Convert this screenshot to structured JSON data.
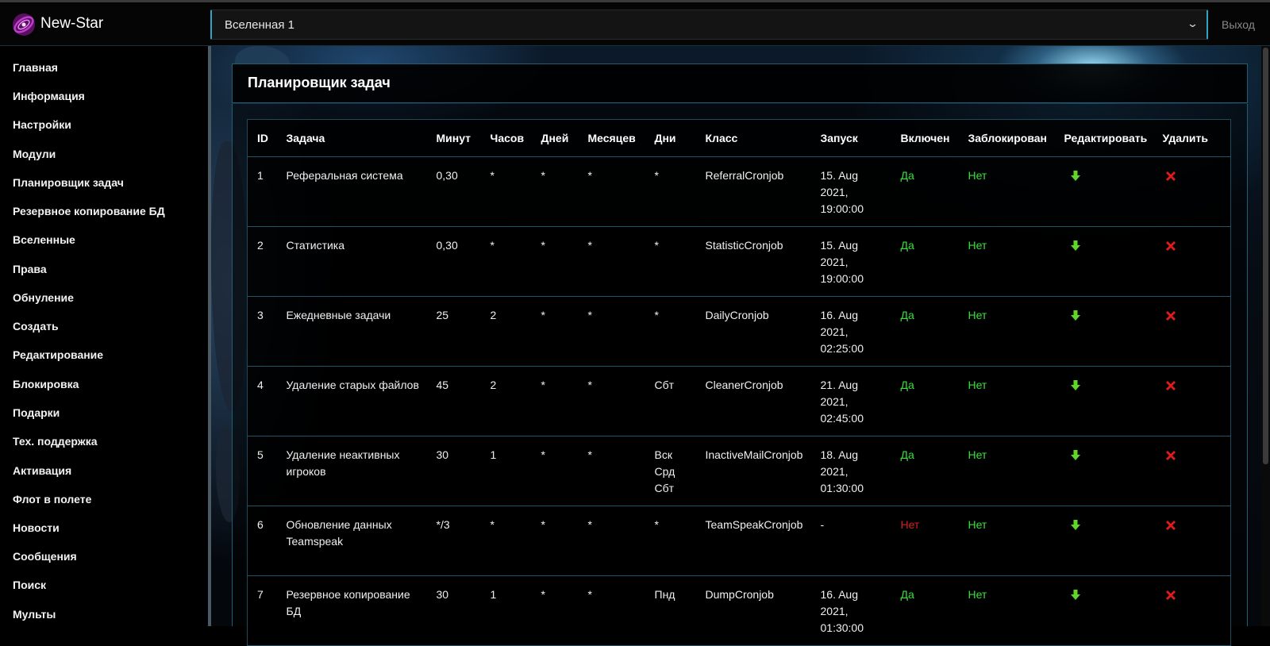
{
  "header": {
    "brand": "New-Star",
    "universe_select": {
      "selected": "Вселенная 1"
    },
    "logout_label": "Выход"
  },
  "sidebar": {
    "items": [
      {
        "label": "Главная"
      },
      {
        "label": "Информация"
      },
      {
        "label": "Настройки"
      },
      {
        "label": "Модули"
      },
      {
        "label": "Планировщик задач"
      },
      {
        "label": "Резервное копирование БД"
      },
      {
        "label": "Вселенные"
      },
      {
        "label": "Права"
      },
      {
        "label": "Обнуление"
      },
      {
        "label": "Создать"
      },
      {
        "label": "Редактирование"
      },
      {
        "label": "Блокировка"
      },
      {
        "label": "Подарки"
      },
      {
        "label": "Тех. поддержка"
      },
      {
        "label": "Активация"
      },
      {
        "label": "Флот в полете"
      },
      {
        "label": "Новости"
      },
      {
        "label": "Сообщения"
      },
      {
        "label": "Поиск"
      },
      {
        "label": "Мульты"
      }
    ]
  },
  "panel": {
    "title": "Планировщик задач"
  },
  "table": {
    "headers": [
      "ID",
      "Задача",
      "Минут",
      "Часов",
      "Дней",
      "Месяцев",
      "Дни",
      "Класс",
      "Запуск",
      "Включен",
      "Заблокирован",
      "Редактировать",
      "Удалить"
    ],
    "rows": [
      {
        "id": "1",
        "task": "Реферальная система",
        "min": "0,30",
        "hour": "*",
        "day": "*",
        "month": "*",
        "dow": "*",
        "class": "ReferralCronjob",
        "run": "15. Aug 2021, 19:00:00",
        "enabled": "Да",
        "locked": "Нет"
      },
      {
        "id": "2",
        "task": "Статистика",
        "min": "0,30",
        "hour": "*",
        "day": "*",
        "month": "*",
        "dow": "*",
        "class": "StatisticCronjob",
        "run": "15. Aug 2021, 19:00:00",
        "enabled": "Да",
        "locked": "Нет"
      },
      {
        "id": "3",
        "task": "Ежедневные задачи",
        "min": "25",
        "hour": "2",
        "day": "*",
        "month": "*",
        "dow": "*",
        "class": "DailyCronjob",
        "run": "16. Aug 2021, 02:25:00",
        "enabled": "Да",
        "locked": "Нет"
      },
      {
        "id": "4",
        "task": "Удаление старых файлов",
        "min": "45",
        "hour": "2",
        "day": "*",
        "month": "*",
        "dow": "Сбт",
        "class": "CleanerCronjob",
        "run": "21. Aug 2021, 02:45:00",
        "enabled": "Да",
        "locked": "Нет"
      },
      {
        "id": "5",
        "task": "Удаление неактивных игроков",
        "min": "30",
        "hour": "1",
        "day": "*",
        "month": "*",
        "dow": "Вск Срд Сбт",
        "class": "InactiveMailCronjob",
        "run": "18. Aug 2021, 01:30:00",
        "enabled": "Да",
        "locked": "Нет"
      },
      {
        "id": "6",
        "task": "Обновление данных Teamspeak",
        "min": "*/3",
        "hour": "*",
        "day": "*",
        "month": "*",
        "dow": "*",
        "class": "TeamSpeakCronjob",
        "run": "-",
        "enabled": "Нет",
        "locked": "Нет"
      },
      {
        "id": "7",
        "task": "Резервное копирование БД",
        "min": "30",
        "hour": "1",
        "day": "*",
        "month": "*",
        "dow": "Пнд",
        "class": "DumpCronjob",
        "run": "16. Aug 2021, 01:30:00",
        "enabled": "Да",
        "locked": "Нет"
      }
    ]
  },
  "colors": {
    "yes": "#37e03c",
    "no_enabled": "#d42020",
    "no_locked": "#37e03c",
    "accent": "#2fa4c7",
    "edit_icon": "#5fd62a",
    "delete_icon": "#e01b1b"
  },
  "icons": {
    "logo": "galaxy-logo",
    "edit": "arrow-down-icon",
    "delete": "delete-x-icon",
    "select": "chevron-down-icon"
  }
}
